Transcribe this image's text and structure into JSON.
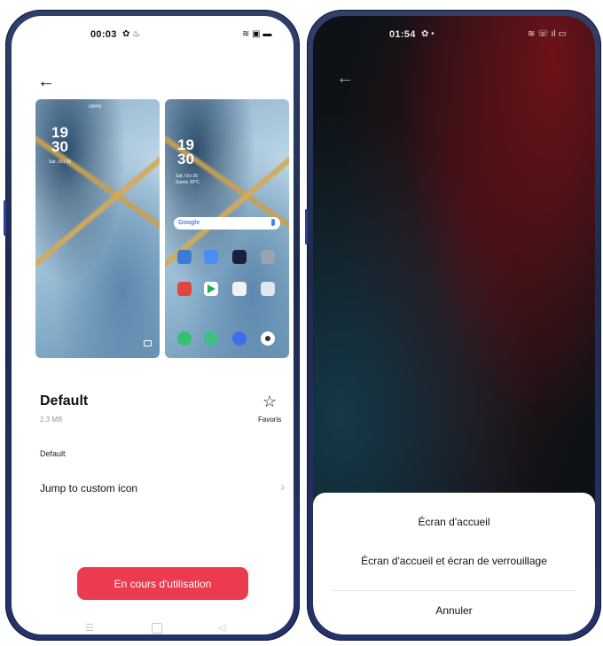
{
  "left": {
    "status": {
      "time": "00:03",
      "left_icons": "✿ ♨",
      "right_icons": "≋ ▣ ▬"
    },
    "preview_lock": {
      "carrier": "OPPO",
      "time_h": "19",
      "time_m": "30",
      "date": "Sat, Oct 26"
    },
    "preview_home": {
      "time_h": "19",
      "time_m": "30",
      "date": "Sat, Oct 26",
      "weather": "Sunny 26°C",
      "search_label": "Google"
    },
    "theme_title": "Default",
    "theme_size": "2.3 MB",
    "favorite_label": "Favoris",
    "section_label": "Default",
    "custom_icon_label": "Jump to custom icon",
    "in_use_button": "En cours d'utilisation"
  },
  "right": {
    "status": {
      "time": "01:54",
      "left_icons": "✿ •",
      "right_icons": "≋ ☏ ıl ▭"
    },
    "sheet": {
      "option_home": "Écran d'accueil",
      "option_home_lock": "Écran d'accueil et écran de verrouillage",
      "cancel": "Annuler"
    }
  },
  "colors": {
    "accent_button": "#ec3b4e",
    "phone_frame": "#25336a"
  },
  "icons": [
    "back-arrow-icon",
    "star-outline-icon",
    "chevron-right-icon",
    "menu-nav-icon",
    "home-nav-icon",
    "back-nav-icon",
    "settings-icon",
    "wifi-icon",
    "battery-icon"
  ]
}
